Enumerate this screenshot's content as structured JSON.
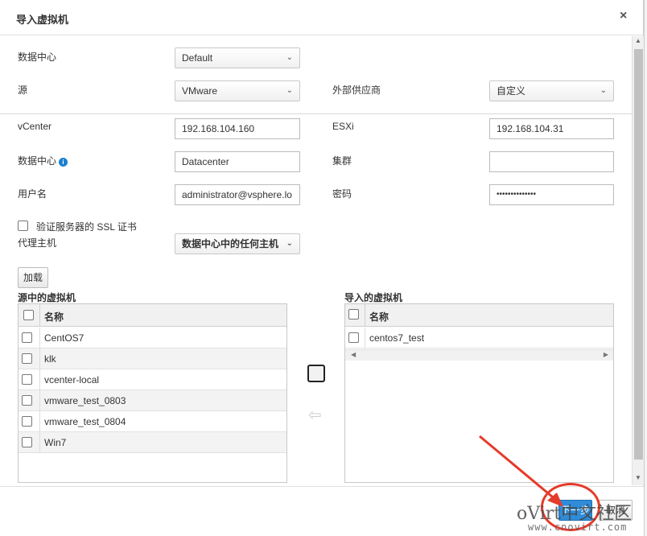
{
  "dialog": {
    "title": "导入虚拟机",
    "close": "×"
  },
  "form": {
    "datacenter_label": "数据中心",
    "datacenter_value": "Default",
    "source_label": "源",
    "source_value": "VMware",
    "provider_label": "外部供应商",
    "provider_value": "自定义",
    "vcenter_label": "vCenter",
    "vcenter_value": "192.168.104.160",
    "esxi_label": "ESXi",
    "esxi_value": "192.168.104.31",
    "dc_label": "数据中心",
    "dc_value": "Datacenter",
    "cluster_label": "集群",
    "cluster_value": "",
    "username_label": "用户名",
    "username_value": "administrator@vsphere.lo",
    "password_label": "密码",
    "password_value": "••••••••••••••",
    "ssl_label": "验证服务器的 SSL 证书",
    "proxy_label": "代理主机",
    "proxy_value": "数据中心中的任何主机",
    "load_button": "加载"
  },
  "source_vms": {
    "title": "源中的虚拟机",
    "header": "名称",
    "rows": [
      "CentOS7",
      "klk",
      "vcenter-local",
      "vmware_test_0803",
      "vmware_test_0804",
      "Win7"
    ]
  },
  "imported_vms": {
    "title": "导入的虚拟机",
    "header": "名称",
    "rows": [
      "centos7_test"
    ]
  },
  "footer": {
    "ok": "下一步",
    "cancel": "取消"
  },
  "watermark": {
    "main": "oVirt中文社区",
    "url": "www.cnovirt.com"
  },
  "colors": {
    "primary": "#2f8cd8",
    "annotation": "#e53b2a"
  }
}
